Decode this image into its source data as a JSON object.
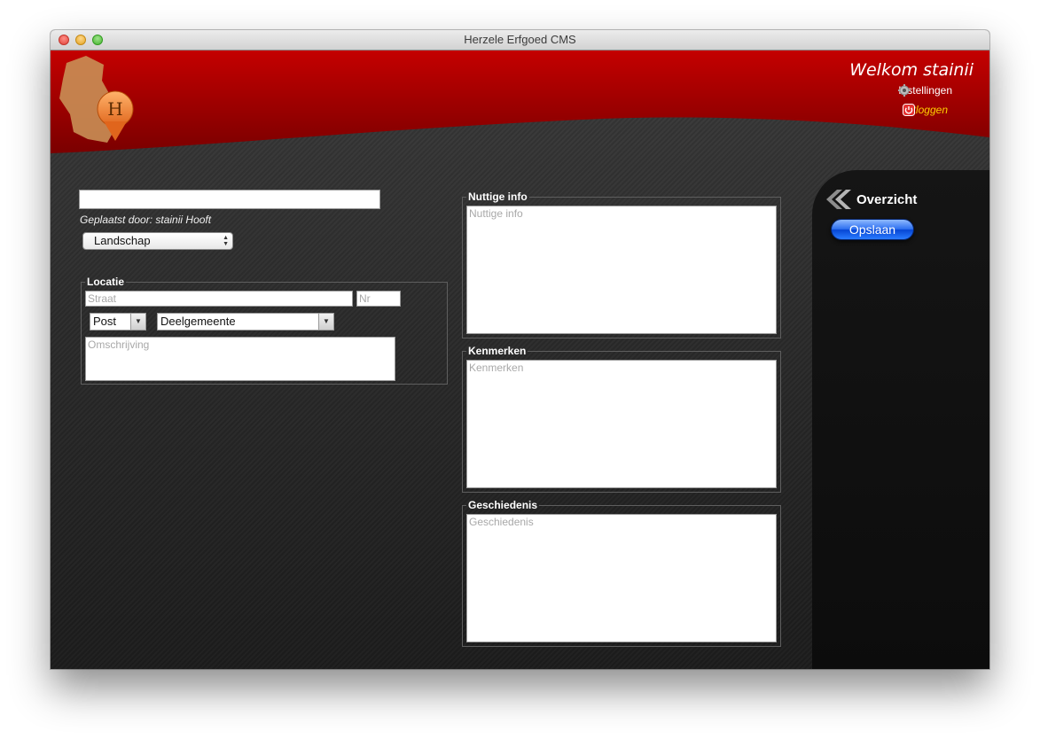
{
  "window": {
    "title": "Herzele Erfgoed CMS"
  },
  "header": {
    "logo_letter": "H",
    "welcome": "Welkom stainii",
    "settings_label": "Instellingen",
    "logout_label": "Uitloggen"
  },
  "form": {
    "title_value": "",
    "posted_by": "Geplaatst door: stainii Hooft",
    "category": "Landschap",
    "locatie": {
      "legend": "Locatie",
      "street_placeholder": "Straat",
      "nr_placeholder": "Nr",
      "post_selected": "Post",
      "deelgemeente_selected": "Deelgemeente",
      "omschrijving_placeholder": "Omschrijving"
    },
    "nuttige_info": {
      "legend": "Nuttige info",
      "placeholder": "Nuttige info"
    },
    "kenmerken": {
      "legend": "Kenmerken",
      "placeholder": "Kenmerken"
    },
    "geschiedenis": {
      "legend": "Geschiedenis",
      "placeholder": "Geschiedenis"
    }
  },
  "sidebar": {
    "overzicht_label": "Overzicht",
    "save_label": "Opslaan"
  },
  "colors": {
    "header_red": "#a50000",
    "logout_yellow": "#ffd000",
    "save_blue": "#0646d4"
  }
}
